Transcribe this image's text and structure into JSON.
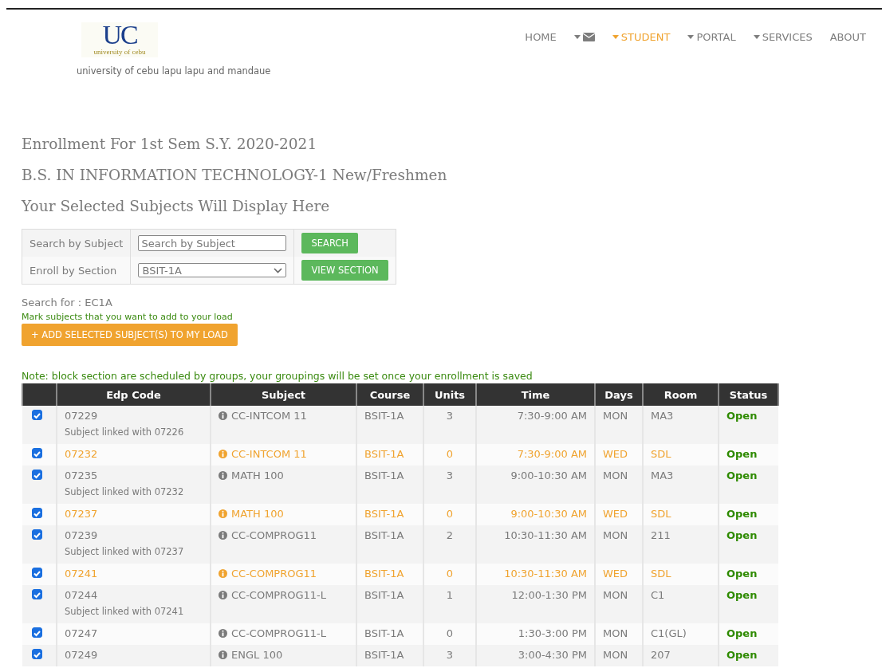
{
  "logo": {
    "letters": "UC",
    "subtitle": "university of cebu"
  },
  "campus": "university of cebu lapu lapu and mandaue",
  "nav": [
    {
      "label": "HOME",
      "kind": "link",
      "selected": false
    },
    {
      "kind": "mail",
      "selected": false
    },
    {
      "label": "STUDENT",
      "kind": "dropdown",
      "selected": true
    },
    {
      "label": "PORTAL",
      "kind": "dropdown",
      "selected": false
    },
    {
      "label": "SERVICES",
      "kind": "dropdown",
      "selected": false
    },
    {
      "label": "ABOUT",
      "kind": "link",
      "selected": false
    }
  ],
  "headings": [
    "Enrollment For 1st Sem S.Y. 2020-2021",
    "B.S. IN INFORMATION TECHNOLOGY-1 New/Freshmen",
    "Your Selected Subjects Will Display Here"
  ],
  "search_form": {
    "subject_label": "Search by Subject",
    "subject_placeholder": "Search by Subject",
    "search_button": "SEARCH",
    "section_label": "Enroll by Section",
    "section_value": "BSIT-1A",
    "view_button": "VIEW SECTION"
  },
  "search_for": "Search for : EC1A",
  "mark_hint": "Mark subjects that you want to add to your load",
  "add_button": "+ ADD SELECTED SUBJECT(S) TO MY LOAD",
  "note": "Note: block section are scheduled by groups, your groupings will be set once your enrollment is saved",
  "table": {
    "columns": [
      "",
      "Edp Code",
      "Subject",
      "Course",
      "Units",
      "Time",
      "Days",
      "Room",
      "Status"
    ],
    "rows": [
      {
        "kind": "main",
        "checked": true,
        "edp": "07229",
        "linked": "Subject linked with 07226",
        "subject": "CC-INTCOM 11",
        "course": "BSIT-1A",
        "units": "3",
        "time": "7:30-9:00 AM",
        "days": "MON",
        "room": "MA3",
        "status": "Open"
      },
      {
        "kind": "group",
        "checked": true,
        "edp": "07232",
        "subject": "CC-INTCOM 11",
        "course": "BSIT-1A",
        "units": "0",
        "time": "7:30-9:00 AM",
        "days": "WED",
        "room": "SDL",
        "status": "Open"
      },
      {
        "kind": "main",
        "checked": true,
        "edp": "07235",
        "linked": "Subject linked with 07232",
        "subject": "MATH 100",
        "course": "BSIT-1A",
        "units": "3",
        "time": "9:00-10:30 AM",
        "days": "MON",
        "room": "MA3",
        "status": "Open"
      },
      {
        "kind": "group",
        "checked": true,
        "edp": "07237",
        "subject": "MATH 100",
        "course": "BSIT-1A",
        "units": "0",
        "time": "9:00-10:30 AM",
        "days": "WED",
        "room": "SDL",
        "status": "Open"
      },
      {
        "kind": "main",
        "checked": true,
        "edp": "07239",
        "linked": "Subject linked with 07237",
        "subject": "CC-COMPROG11",
        "course": "BSIT-1A",
        "units": "2",
        "time": "10:30-11:30 AM",
        "days": "MON",
        "room": "211",
        "status": "Open"
      },
      {
        "kind": "group",
        "checked": true,
        "edp": "07241",
        "subject": "CC-COMPROG11",
        "course": "BSIT-1A",
        "units": "0",
        "time": "10:30-11:30 AM",
        "days": "WED",
        "room": "SDL",
        "status": "Open"
      },
      {
        "kind": "main",
        "checked": true,
        "edp": "07244",
        "linked": "Subject linked with 07241",
        "subject": "CC-COMPROG11-L",
        "course": "BSIT-1A",
        "units": "1",
        "time": "12:00-1:30 PM",
        "days": "MON",
        "room": "C1",
        "status": "Open"
      },
      {
        "kind": "main",
        "checked": true,
        "edp": "07247",
        "subject": "CC-COMPROG11-L",
        "course": "BSIT-1A",
        "units": "0",
        "time": "1:30-3:00 PM",
        "days": "MON",
        "room": "C1(GL)",
        "status": "Open"
      },
      {
        "kind": "main",
        "checked": true,
        "edp": "07249",
        "subject": "ENGL 100",
        "course": "BSIT-1A",
        "units": "3",
        "time": "3:00-4:30 PM",
        "days": "MON",
        "room": "207",
        "status": "Open"
      }
    ]
  }
}
